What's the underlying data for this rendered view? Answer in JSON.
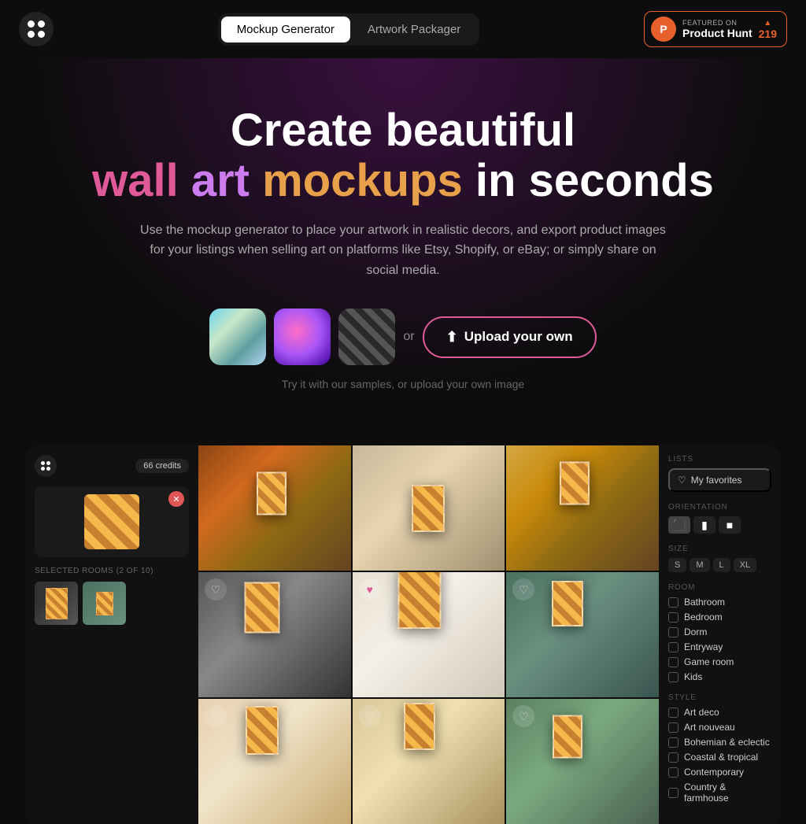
{
  "nav": {
    "tab1": "Mockup Generator",
    "tab2": "Artwork Packager",
    "active_tab": "tab1",
    "ph_featured": "FEATURED ON",
    "ph_name": "Product Hunt",
    "ph_count": "219"
  },
  "hero": {
    "line1": "Create beautiful",
    "word_wall": "wall",
    "word_art": "art",
    "word_mockups": "mockups",
    "word_in": "in",
    "word_seconds": "seconds",
    "subtitle": "Use the mockup generator to place your artwork in realistic decors, and export product images for your listings when selling art on platforms like Etsy, Shopify, or eBay; or simply share on social media.",
    "or_text": "or",
    "upload_label": "Upload your own",
    "hint": "Try it with our samples, or upload your own image"
  },
  "left_panel": {
    "credits": "66 credits",
    "selected_label": "SELECTED ROOMS (2 OF 10)"
  },
  "right_panel": {
    "lists_label": "LISTS",
    "my_favorites": "My favorites",
    "orientation_label": "ORIENTATION",
    "size_label": "SIZE",
    "size_s": "S",
    "size_m": "M",
    "size_l": "L",
    "size_xl": "XL",
    "room_label": "ROOM",
    "rooms": [
      "Bathroom",
      "Bedroom",
      "Dorm",
      "Entryway",
      "Game room",
      "Kids"
    ],
    "style_label": "STYLE",
    "styles": [
      "Art deco",
      "Art nouveau",
      "Bohemian & eclectic",
      "Coastal & tropical",
      "Contemporary",
      "Country & farmhouse"
    ]
  },
  "grid": {
    "liked_index": 1
  }
}
